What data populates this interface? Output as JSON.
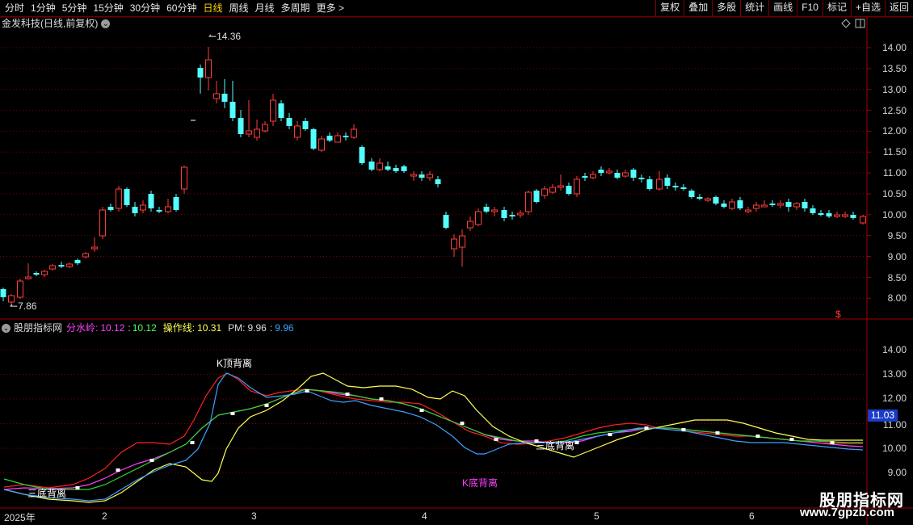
{
  "toolbar": {
    "periods": [
      "分时",
      "1分钟",
      "5分钟",
      "15分钟",
      "30分钟",
      "60分钟",
      "日线",
      "周线",
      "月线",
      "多周期",
      "更多"
    ],
    "active_period": "日线",
    "more_arrow": ">",
    "buttons": [
      "复权",
      "叠加",
      "多股",
      "统计",
      "画线",
      "F10",
      "标记",
      "+自选",
      "返回"
    ]
  },
  "stock": {
    "title": "金发科技(日线,前复权)",
    "high_label": "14.36",
    "low_label": "7.86",
    "marker": "$"
  },
  "price_axis": [
    "14.00",
    "13.50",
    "13.00",
    "12.50",
    "12.00",
    "11.50",
    "11.00",
    "10.50",
    "10.00",
    "9.50",
    "9.00",
    "8.50",
    "8.00"
  ],
  "indicator": {
    "name": "股朋指标网",
    "fsl_label": "分水岭:",
    "fsl_val1": "10.12",
    "fsl_sep": ":",
    "fsl_val2": "10.12",
    "czx_label": "操作线:",
    "czx_val": "10.31",
    "pm_label": "PM:",
    "pm_val1": "9.96",
    "pm_sep": ":",
    "pm_val2": "9.96",
    "annotations": {
      "k_top": "K顶背离",
      "three_bottom_1": "三底背离",
      "three_bottom_2": "三底背离",
      "k_bottom": "K底背离"
    },
    "current_value": "11.03"
  },
  "indicator_axis": [
    "14.00",
    "13.00",
    "12.00",
    "11.00",
    "10.00",
    "9.00"
  ],
  "date_axis": [
    "2025年",
    "2",
    "3",
    "4",
    "5",
    "6"
  ],
  "watermark": {
    "line1": "股朋指标网",
    "line2": "www.7gpzb.com"
  },
  "colors": {
    "up": "#ff3c3c",
    "down": "#54ffff",
    "grid": "#7a0000",
    "fsl": "#ff40ff",
    "czx": "#ffff55",
    "pm": "#3fa0ff"
  }
}
